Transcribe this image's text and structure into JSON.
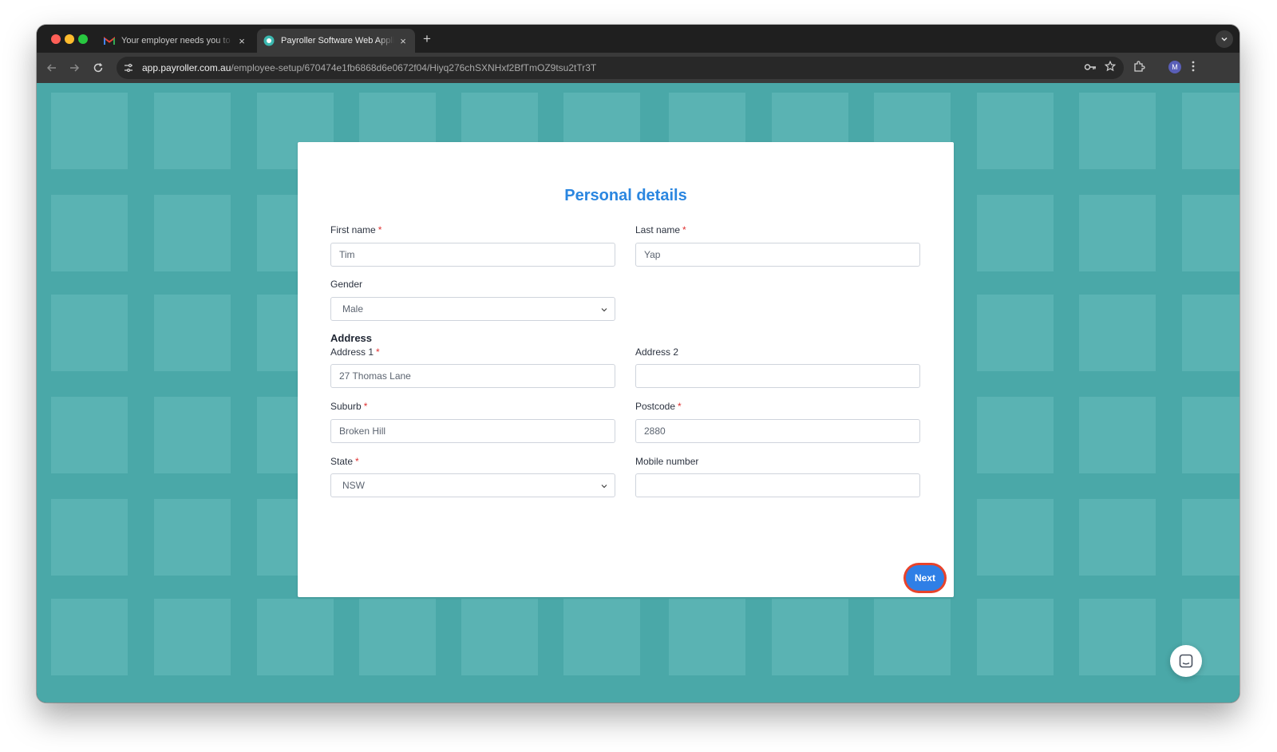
{
  "browser": {
    "tabs": [
      {
        "title": "Your employer needs you to fill",
        "favicon": "gmail-icon",
        "active": false
      },
      {
        "title": "Payroller Software Web Application",
        "favicon": "payroller-icon",
        "active": true
      }
    ],
    "new_tab": "+",
    "tab_close": "×",
    "address_bar": {
      "host": "app.payroller.com.au",
      "path": "/employee-setup/670474e1fb6868d6e0672f04/Hiyq276chSXNHxf2BfTmOZ9tsu2tTr3T"
    },
    "profile_initial": "M"
  },
  "form": {
    "title": "Personal details",
    "required_marker": "*",
    "first_name": {
      "label": "First name",
      "value": "Tim"
    },
    "last_name": {
      "label": "Last name",
      "value": "Yap"
    },
    "gender": {
      "label": "Gender",
      "value": "Male"
    },
    "address_section": "Address",
    "address1": {
      "label": "Address 1",
      "value": "27 Thomas Lane"
    },
    "address2": {
      "label": "Address 2",
      "value": ""
    },
    "suburb": {
      "label": "Suburb",
      "value": "Broken Hill"
    },
    "postcode": {
      "label": "Postcode",
      "value": "2880"
    },
    "state": {
      "label": "State",
      "value": "NSW"
    },
    "mobile": {
      "label": "Mobile number",
      "value": ""
    },
    "next_label": "Next"
  },
  "colors": {
    "background": "#4aa8a8",
    "tile": "#5ab3b3",
    "title": "#2a86e0",
    "button": "#2f7fe6",
    "highlight": "#e8432b",
    "required": "#e03131"
  }
}
